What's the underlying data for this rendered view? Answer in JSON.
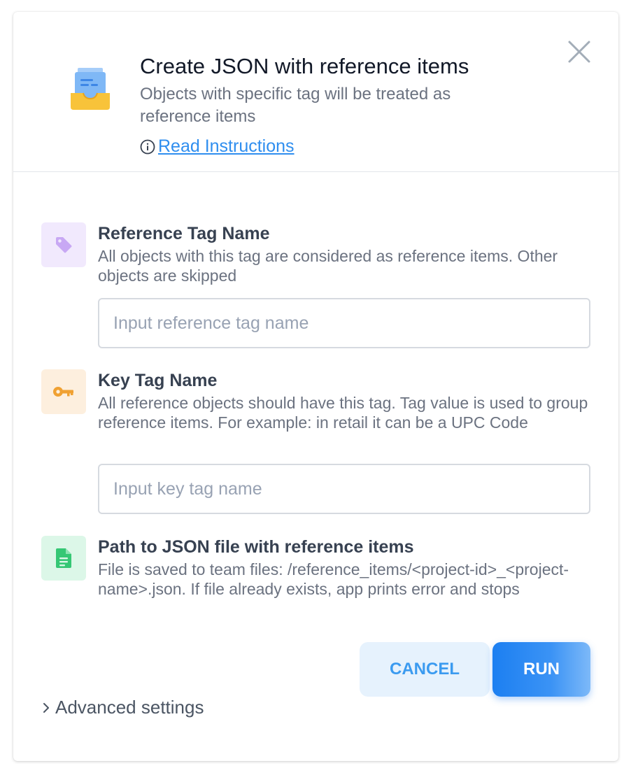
{
  "header": {
    "title": "Create JSON with reference items",
    "subtitle": "Objects with specific tag will be treated as reference items",
    "instructions_label": "Read Instructions",
    "app_icon": "inbox-tray-icon",
    "close_icon": "close-icon"
  },
  "sections": [
    {
      "icon": "tag-icon",
      "title": "Reference Tag Name",
      "description": "All objects with this tag are considered as reference items. Other objects are skipped",
      "input_placeholder": "Input reference tag name",
      "input_value": ""
    },
    {
      "icon": "key-icon",
      "title": "Key Tag Name",
      "description": "All reference objects should have this tag. Tag value is used to group reference items. For example: in retail it can be a UPC Code",
      "input_placeholder": "Input key tag name",
      "input_value": ""
    },
    {
      "icon": "file-icon",
      "title": "Path to JSON file with reference items",
      "description": "File is saved to team files: /reference_items/<project-id>_<project-name>.json. If file already exists, app prints error and stops"
    }
  ],
  "buttons": {
    "cancel_label": "CANCEL",
    "run_label": "RUN"
  },
  "advanced": {
    "label": "Advanced settings"
  },
  "colors": {
    "link": "#2f8eef",
    "primary": "#1c7ff1",
    "tag_bg": "#f1e9fd",
    "key_bg": "#fdefde",
    "file_bg": "#dcf7e8"
  }
}
